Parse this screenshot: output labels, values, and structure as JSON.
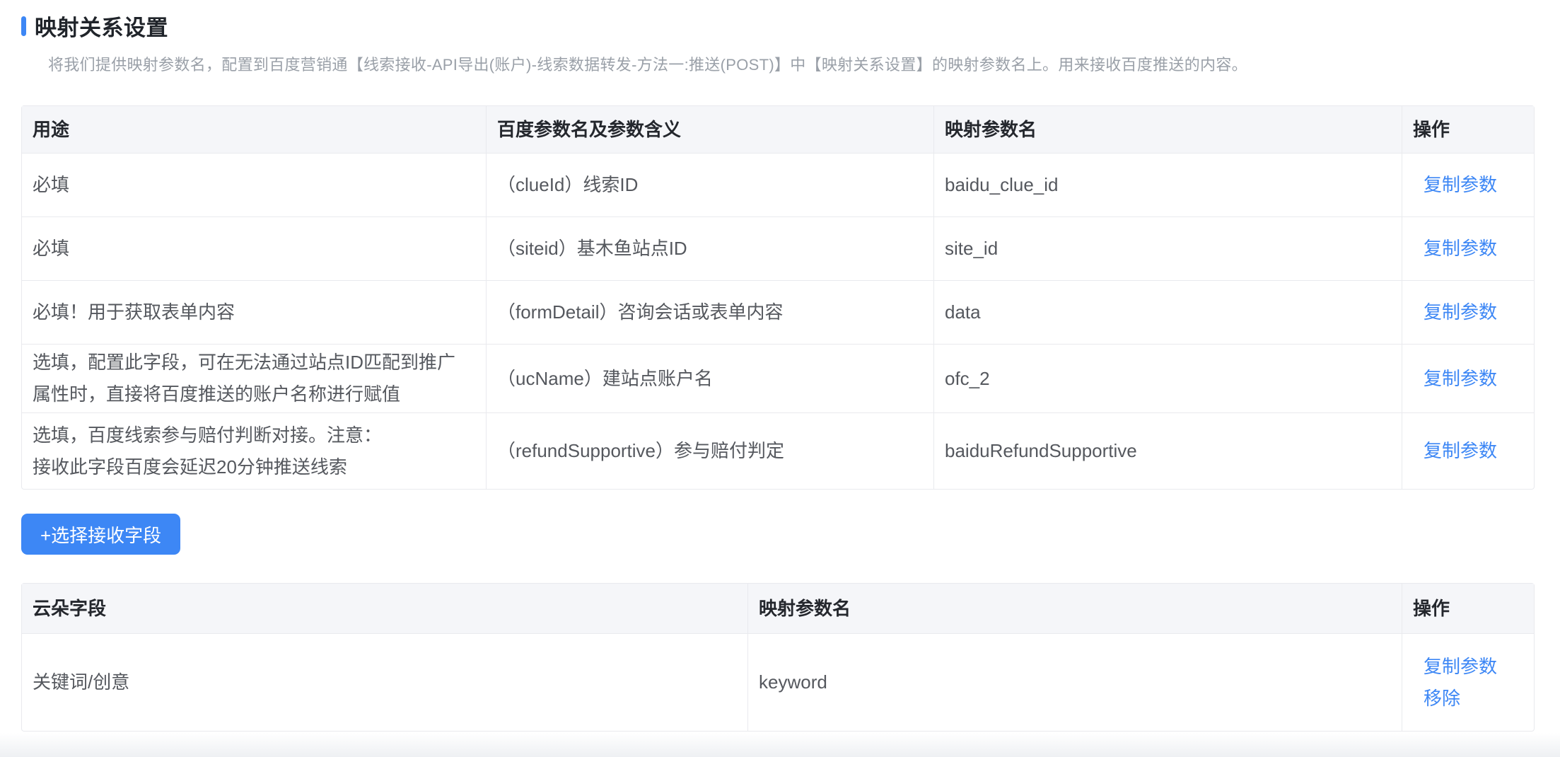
{
  "page": {
    "title": "映射关系设置",
    "subtitle": "将我们提供映射参数名，配置到百度营销通【线索接收-API导出(账户)-线索数据转发-方法一:推送(POST)】中【映射关系设置】的映射参数名上。用来接收百度推送的内容。",
    "accent_color": "#3d87f5",
    "link_color": "#3d87f5"
  },
  "mapping_table": {
    "headers": [
      "用途",
      "百度参数名及参数含义",
      "映射参数名",
      "操作"
    ],
    "copy_label": "复制参数",
    "rows": [
      {
        "usage": "必填",
        "baidu_param": "（clueId）线索ID",
        "mapping_param": "baidu_clue_id"
      },
      {
        "usage": "必填",
        "baidu_param": "（siteid）基木鱼站点ID",
        "mapping_param": "site_id"
      },
      {
        "usage": "必填！用于获取表单内容",
        "baidu_param": "（formDetail）咨询会话或表单内容",
        "mapping_param": "data"
      },
      {
        "usage": "选填，配置此字段，可在无法通过站点ID匹配到推广属性时，直接将百度推送的账户名称进行赋值",
        "baidu_param": "（ucName）建站点账户名",
        "mapping_param": "ofc_2"
      },
      {
        "usage": "选填，百度线索参与赔付判断对接。注意：\n接收此字段百度会延迟20分钟推送线索",
        "baidu_param": "（refundSupportive）参与赔付判定",
        "mapping_param": "baiduRefundSupportive"
      }
    ]
  },
  "add_button": {
    "label": "+选择接收字段"
  },
  "cloud_table": {
    "headers": [
      "云朵字段",
      "映射参数名",
      "操作"
    ],
    "copy_label": "复制参数",
    "remove_label": "移除",
    "rows": [
      {
        "field": "关键词/创意",
        "mapping_param": "keyword"
      }
    ]
  }
}
